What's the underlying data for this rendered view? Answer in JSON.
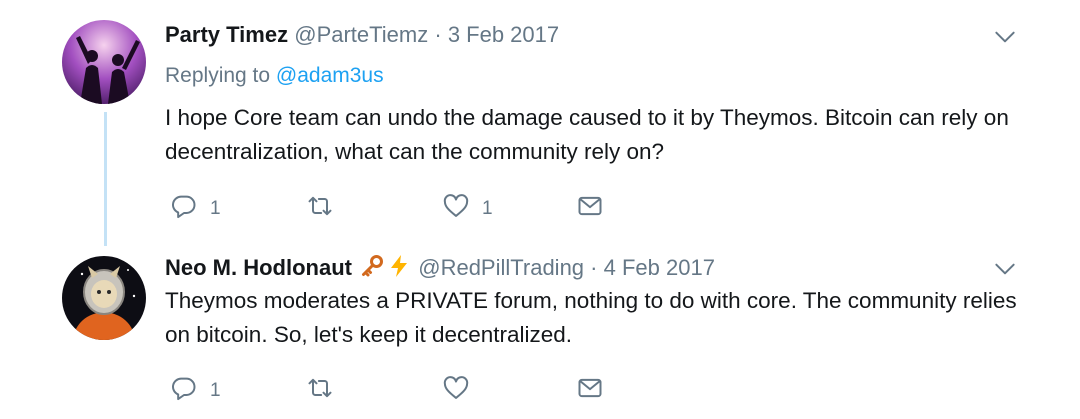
{
  "tweets": [
    {
      "name": "Party Timez",
      "handle": "@ParteTiemz",
      "dot": "·",
      "date": "3 Feb 2017",
      "replying_prefix": "Replying to",
      "replying_to": "@adam3us",
      "text": "I hope Core team can undo the damage caused to it by Theymos. Bitcoin can rely on decentralization, what can the community rely on?",
      "reply_count": "1",
      "retweet_count": "",
      "like_count": "1"
    },
    {
      "name": "Neo M. Hodlonaut",
      "name_emojis": [
        "key-emoji",
        "lightning-emoji"
      ],
      "handle": "@RedPillTrading",
      "dot": "·",
      "date": "4 Feb 2017",
      "text": "Theymos moderates a PRIVATE forum, nothing to do with core. The community relies on bitcoin. So, let's keep it decentralized.",
      "reply_count": "1",
      "retweet_count": "",
      "like_count": ""
    }
  ],
  "colors": {
    "thread_line": "#c4e2f6",
    "mention": "#1da1f2",
    "muted": "#657786",
    "text": "#14171a"
  },
  "icons": [
    "reply-icon",
    "retweet-icon",
    "like-icon",
    "message-icon",
    "chevron-down-icon"
  ]
}
